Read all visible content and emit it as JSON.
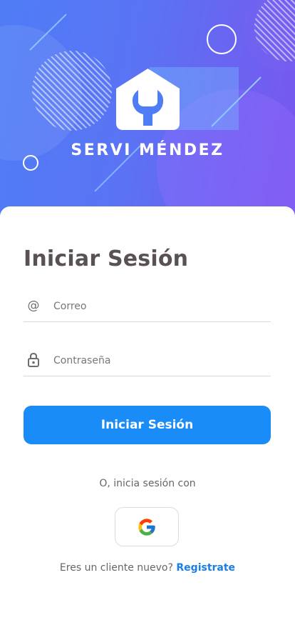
{
  "header": {
    "brand_name": "SERVI MÉNDEZ",
    "logo_icon": "wrench-house-icon",
    "gradient_colors": [
      "#4f7df6",
      "#7a55ee"
    ]
  },
  "login": {
    "title": "Iniciar Sesión",
    "email_icon": "at-icon",
    "email_placeholder": "Correo",
    "password_icon": "lock-icon",
    "password_placeholder": "Contraseña",
    "submit_label": "Iniciar Sesión",
    "accent_color": "#1a8cf8"
  },
  "social": {
    "divider_text": "O, inicia sesión con",
    "google_icon": "google-icon"
  },
  "footer": {
    "prompt": "Eres un cliente nuevo?",
    "register_label": "Registrate"
  }
}
